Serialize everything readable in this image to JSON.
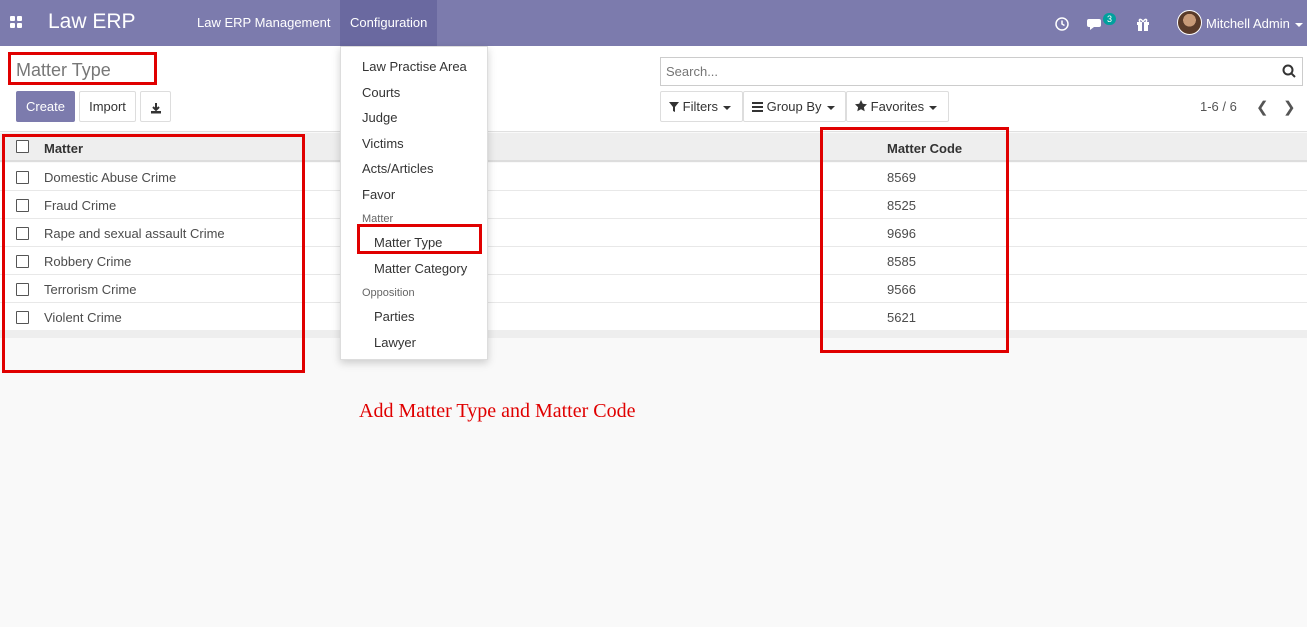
{
  "navbar": {
    "brand": "Law ERP",
    "menus": [
      "Law ERP Management",
      "Configuration"
    ],
    "chat_badge": "3",
    "user": "Mitchell Admin"
  },
  "page": {
    "title": "Matter Type",
    "buttons": {
      "create": "Create",
      "import": "Import"
    }
  },
  "search": {
    "placeholder": "Search..."
  },
  "filters": {
    "filters": "Filters",
    "group_by": "Group By",
    "favorites": "Favorites"
  },
  "pager": {
    "text": "1-6 / 6"
  },
  "table": {
    "headers": [
      "Matter",
      "Matter Code"
    ],
    "rows": [
      {
        "matter": "Domestic Abuse Crime",
        "code": "8569"
      },
      {
        "matter": "Fraud Crime",
        "code": "8525"
      },
      {
        "matter": "Rape and sexual assault Crime",
        "code": "9696"
      },
      {
        "matter": "Robbery Crime",
        "code": "8585"
      },
      {
        "matter": "Terrorism Crime",
        "code": "9566"
      },
      {
        "matter": "Violent Crime",
        "code": "5621"
      }
    ]
  },
  "dropdown": {
    "items": [
      "Law Practise Area",
      "Courts",
      "Judge",
      "Victims",
      "Acts/Articles",
      "Favor"
    ],
    "section_matter": "Matter",
    "matter_items": [
      "Matter Type",
      "Matter Category"
    ],
    "section_opposition": "Opposition",
    "opposition_items": [
      "Parties",
      "Lawyer"
    ]
  },
  "annotation": {
    "text": "Add Matter Type and Matter Code"
  },
  "colors": {
    "navbar": "#7c7bad",
    "primary": "#7c7bad",
    "annotation": "#e00000",
    "badge": "#00a09d"
  }
}
